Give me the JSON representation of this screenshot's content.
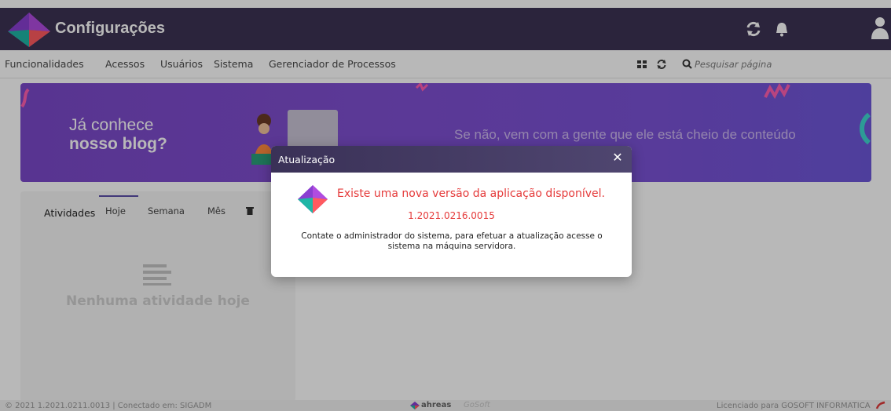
{
  "header": {
    "title": "Configurações",
    "icons": [
      "refresh-icon",
      "bell-icon",
      "user-icon"
    ]
  },
  "menu": {
    "items": [
      {
        "label": "Funcionalidades"
      },
      {
        "label": "Acessos"
      },
      {
        "label": "Usuários"
      },
      {
        "label": "Sistema"
      },
      {
        "label": "Gerenciador de Processos"
      }
    ],
    "search_placeholder": "Pesquisar página"
  },
  "banner": {
    "line1": "Já conhece",
    "line2": "nosso blog?",
    "right_text": "Se não, vem com a gente que ele está cheio de conteúdo"
  },
  "activities": {
    "label": "Atividades",
    "tabs": [
      {
        "label": "Hoje"
      },
      {
        "label": "Semana"
      },
      {
        "label": "Mês"
      }
    ],
    "empty_text": "Nenhuma atividade hoje"
  },
  "footer": {
    "left": "© 2021 1.2021.0211.0013 | Conectado em: SIGADM",
    "brand": "ahreas",
    "brand2": "GoSoft",
    "right": "Licenciado para GOSOFT INFORMATICA"
  },
  "modal": {
    "title": "Atualização",
    "message": "Existe uma nova versão da aplicação disponível.",
    "version": "1.2021.0216.0015",
    "note": "Contate o administrador do sistema, para efetuar a atualização acesse o sistema na máquina servidora."
  },
  "colors": {
    "header_bg": "#3c3254",
    "banner_bg": "#7b49c9",
    "alert_red": "#e53a3a"
  }
}
